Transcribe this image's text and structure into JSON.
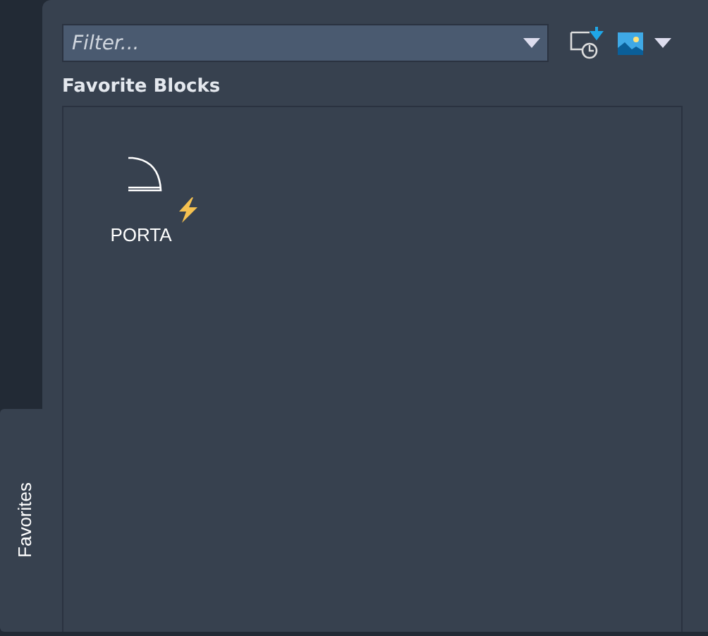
{
  "filter": {
    "placeholder": "Filter..."
  },
  "heading": "Favorite Blocks",
  "blocks": [
    {
      "name": "PORTA",
      "dynamic": true
    }
  ],
  "side_tabs": [
    {
      "label": "Favorites",
      "selected": true
    }
  ]
}
